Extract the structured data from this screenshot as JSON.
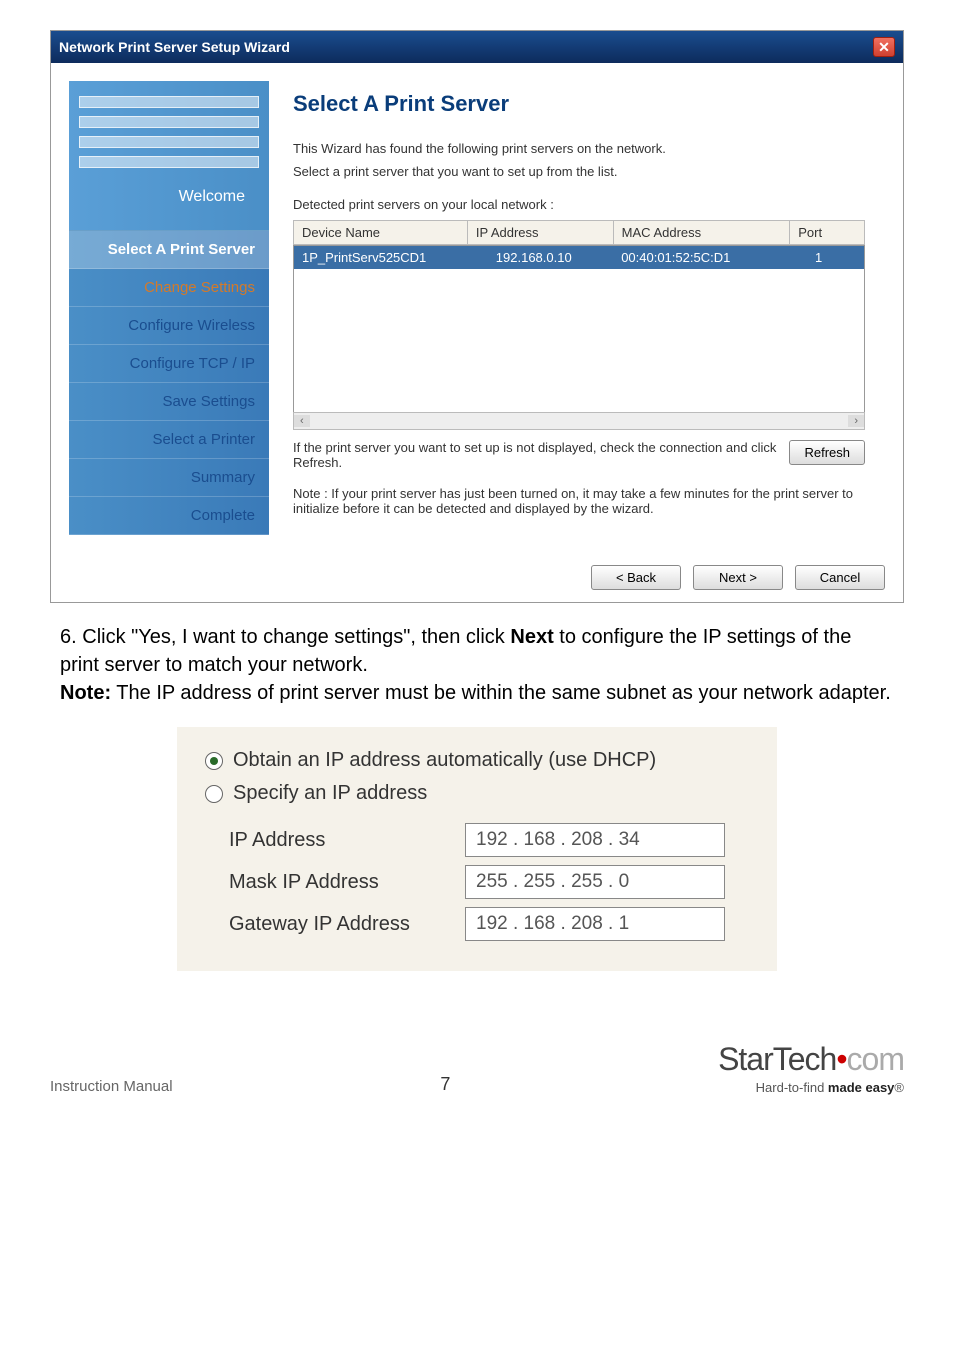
{
  "dialog": {
    "title": "Network Print Server Setup Wizard",
    "sidebar": {
      "welcome": "Welcome",
      "items": [
        "Select A Print Server",
        "Change Settings",
        "Configure Wireless",
        "Configure TCP / IP",
        "Save Settings",
        "Select a Printer",
        "Summary",
        "Complete"
      ]
    },
    "main": {
      "heading": "Select A Print Server",
      "intro1": "This Wizard has found the following print servers on the network.",
      "intro2": "Select a print server that you want to set up from the list.",
      "detected_label": "Detected print servers on your local network :",
      "columns": {
        "c1": "Device Name",
        "c2": "IP Address",
        "c3": "MAC Address",
        "c4": "Port"
      },
      "row": {
        "device": "1P_PrintServ525CD1",
        "ip": "192.168.0.10",
        "mac": "00:40:01:52:5C:D1",
        "port": "1"
      },
      "help1": "If the print server you want to set up is not displayed, check the connection and click Refresh.",
      "note": "Note : If your print server has just been turned on, it may take a few minutes for the print server to initialize before it can be detected and displayed by the wizard.",
      "refresh": "Refresh"
    },
    "buttons": {
      "back": "< Back",
      "next": "Next >",
      "cancel": "Cancel"
    }
  },
  "instruction": {
    "num": "6.",
    "text_a": "Click \"Yes, I want to change settings\", then click ",
    "bold1": "Next",
    "text_b": " to configure the IP settings of the print server to match your network.",
    "note_label": "Note:",
    "note_text": " The IP address of print server must be within the same subnet as your network adapter."
  },
  "ipbox": {
    "opt_dhcp": "Obtain an IP address automatically (use DHCP)",
    "opt_static": "Specify an IP address",
    "ip_label": "IP Address",
    "ip_val": "192 . 168 . 208 .  34",
    "mask_label": "Mask IP Address",
    "mask_val": "255 . 255 . 255 .   0",
    "gw_label": "Gateway IP Address",
    "gw_val": "192 . 168 . 208 .   1"
  },
  "footer": {
    "left": "Instruction Manual",
    "page": "7",
    "brand_a": "StarTech",
    "brand_b": "com",
    "tagline_a": "Hard-to-find ",
    "tagline_b": "made easy",
    "reg": "®"
  }
}
